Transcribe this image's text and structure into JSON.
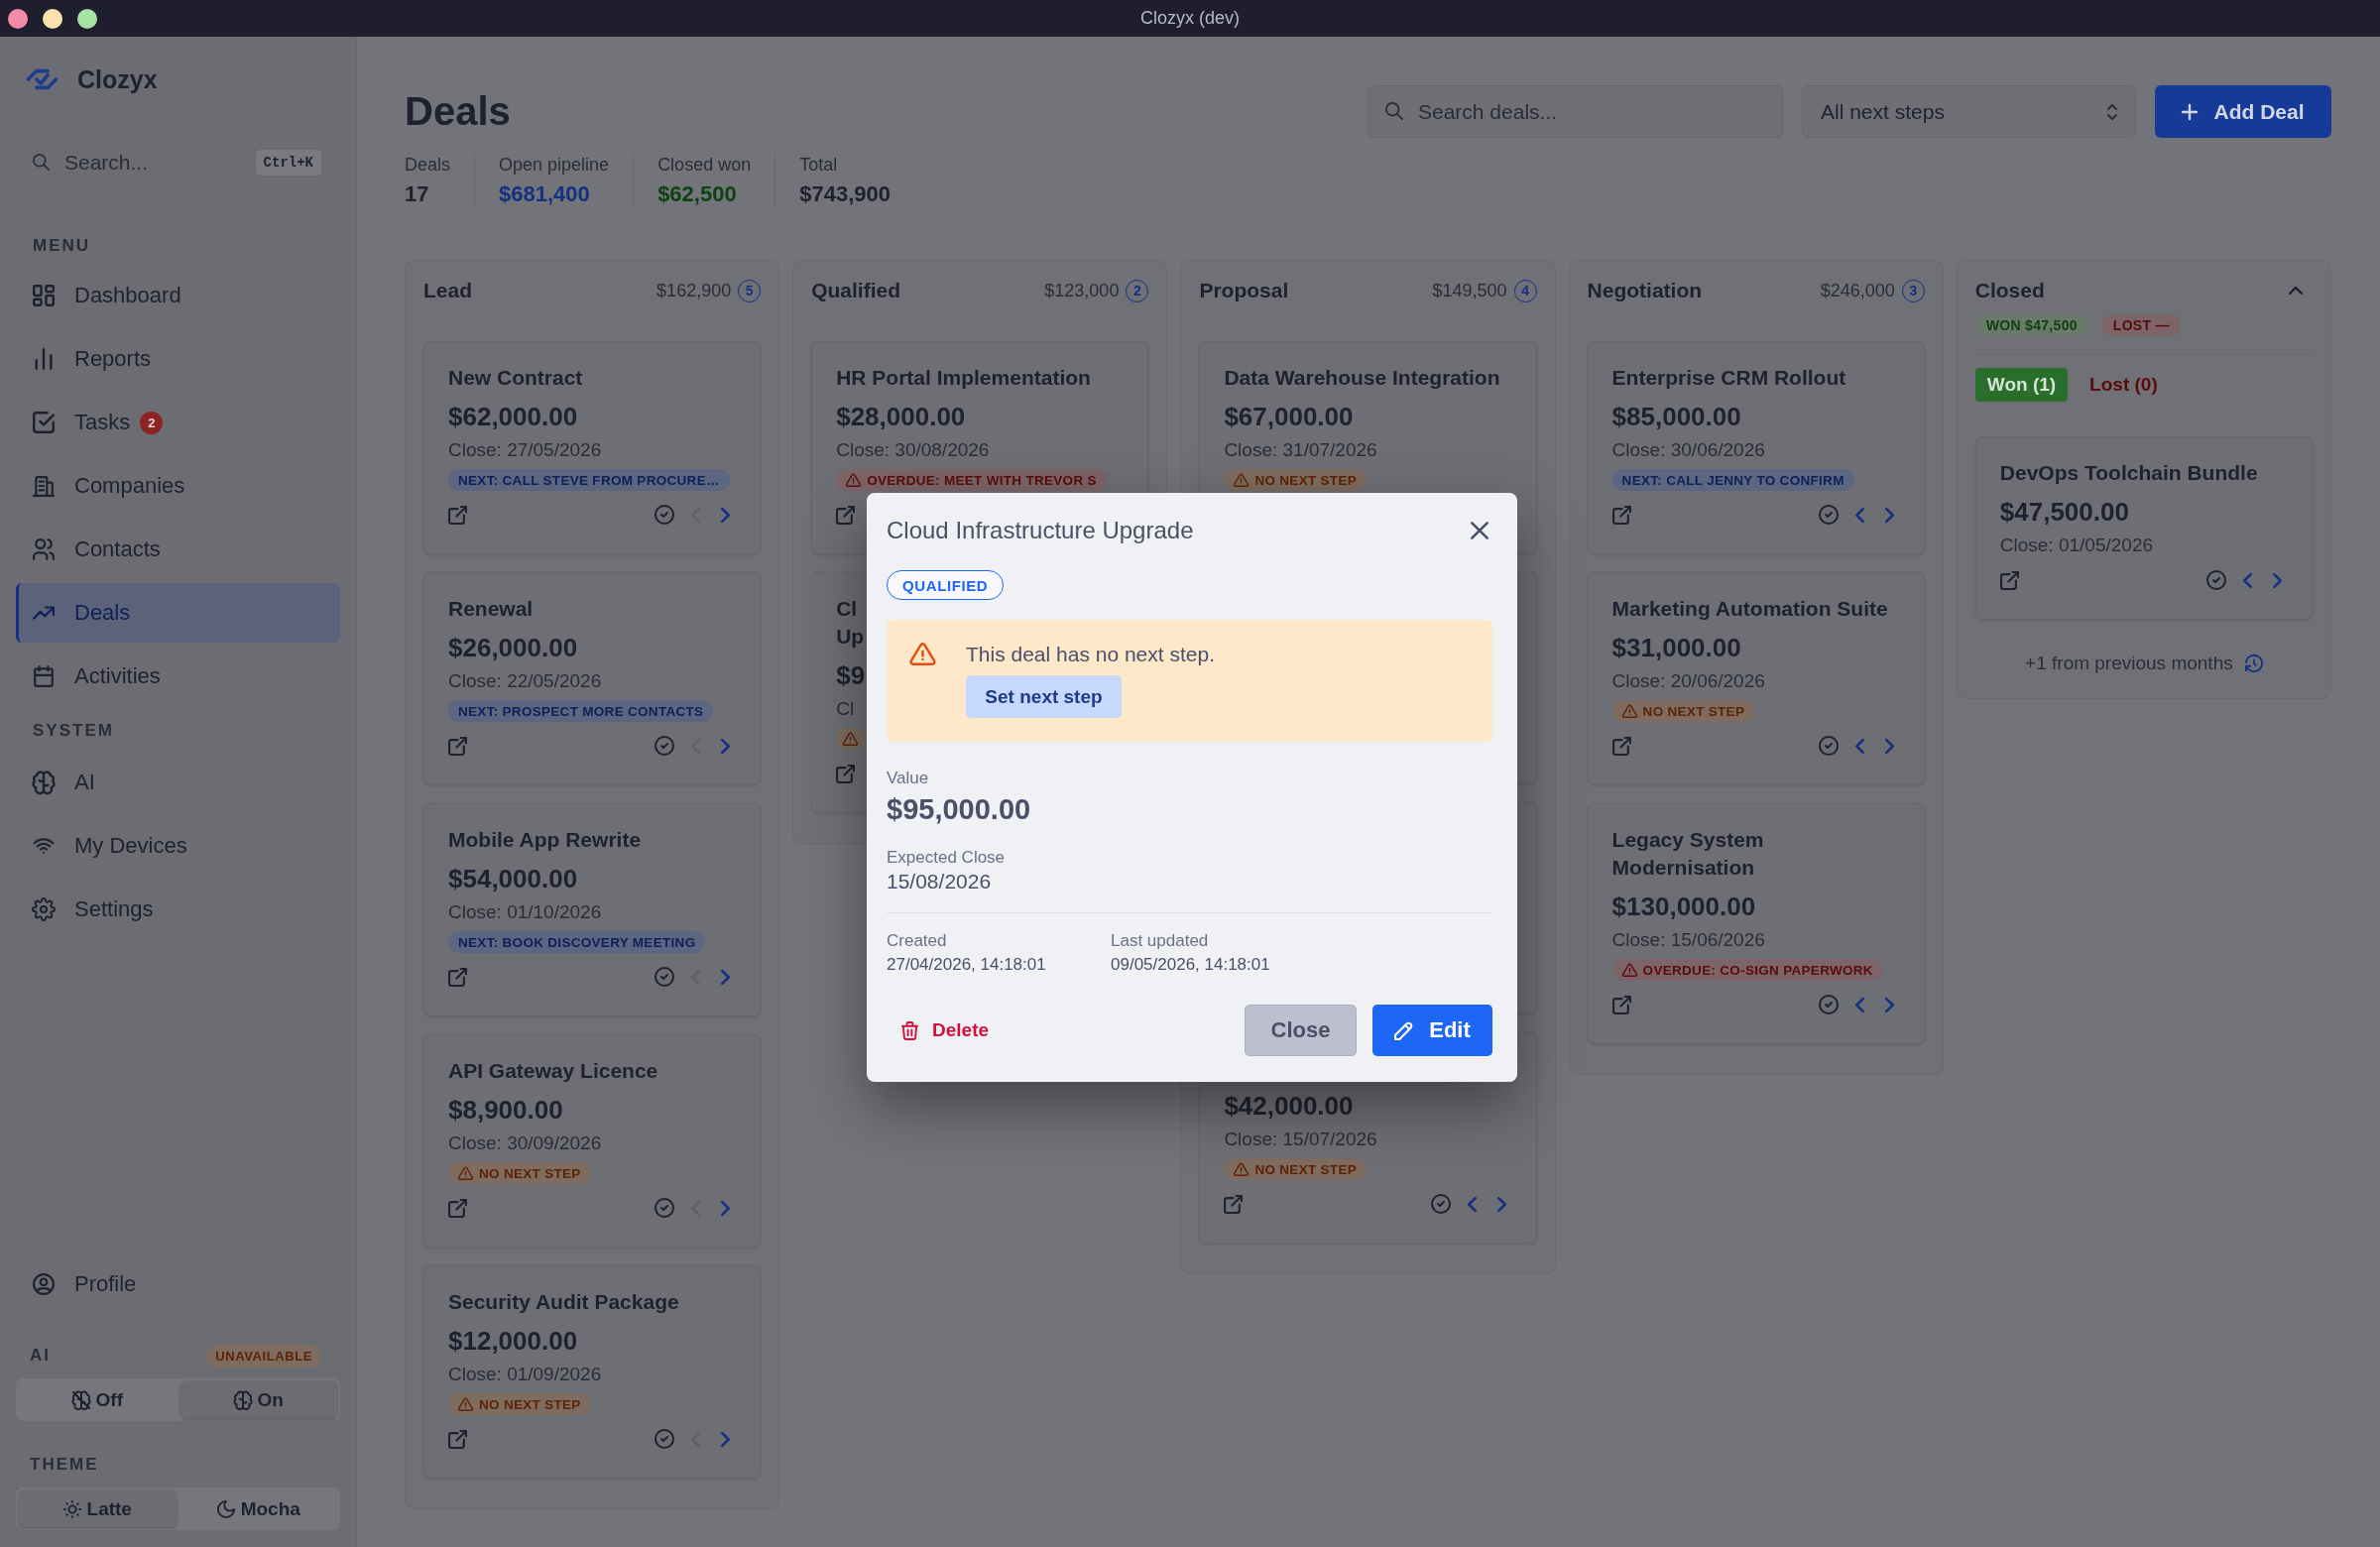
{
  "window": {
    "title": "Clozyx (dev)"
  },
  "sidebar": {
    "brand": "Clozyx",
    "search": {
      "placeholder": "Search...",
      "shortcut": "Ctrl+K"
    },
    "sections": [
      {
        "heading": "MENU",
        "items": [
          {
            "label": "Dashboard",
            "selected": false
          },
          {
            "label": "Reports",
            "selected": false
          },
          {
            "label": "Tasks",
            "selected": false,
            "badge": "2"
          },
          {
            "label": "Companies",
            "selected": false
          },
          {
            "label": "Contacts",
            "selected": false
          },
          {
            "label": "Deals",
            "selected": true
          },
          {
            "label": "Activities",
            "selected": false
          }
        ]
      },
      {
        "heading": "SYSTEM",
        "items": [
          {
            "label": "AI",
            "selected": false
          },
          {
            "label": "My Devices",
            "selected": false
          },
          {
            "label": "Settings",
            "selected": false
          }
        ]
      }
    ],
    "profile": {
      "label": "Profile"
    },
    "ai": {
      "heading": "AI",
      "status": "UNAVAILABLE",
      "options": [
        {
          "label": "Off",
          "selected": false
        },
        {
          "label": "On",
          "selected": true
        }
      ]
    },
    "theme": {
      "heading": "THEME",
      "options": [
        {
          "label": "Latte",
          "selected": true
        },
        {
          "label": "Mocha",
          "selected": false
        }
      ]
    }
  },
  "header": {
    "title": "Deals",
    "search": {
      "placeholder": "Search deals..."
    },
    "filter": {
      "value": "All next steps"
    },
    "add_button": "Add Deal"
  },
  "stats": [
    {
      "label": "Deals",
      "value": "17",
      "color": "#1f2130"
    },
    {
      "label": "Open pipeline",
      "value": "$681,400",
      "color": "#143080"
    },
    {
      "label": "Closed won",
      "value": "$62,500",
      "color": "#0f4212"
    },
    {
      "label": "Total",
      "value": "$743,900",
      "color": "#1f2130"
    }
  ],
  "columns": [
    {
      "name": "Lead",
      "total": "$162,900",
      "count": "5",
      "cards": [
        {
          "title": "New Contract",
          "amount": "$62,000.00",
          "close": "Close: 27/05/2026",
          "tag": {
            "kind": "next",
            "text": "NEXT: CALL STEVE FROM PROCURE…"
          },
          "actions": [
            {
              "kind": "link",
              "disabled": false
            },
            {
              "kind": "check",
              "disabled": false
            },
            {
              "kind": "prev",
              "disabled": true
            },
            {
              "kind": "next",
              "disabled": false
            }
          ]
        },
        {
          "title": "Renewal",
          "amount": "$26,000.00",
          "close": "Close: 22/05/2026",
          "tag": {
            "kind": "next",
            "text": "NEXT: PROSPECT MORE CONTACTS"
          },
          "actions": [
            {
              "kind": "link",
              "disabled": false
            },
            {
              "kind": "check",
              "disabled": false
            },
            {
              "kind": "prev",
              "disabled": true
            },
            {
              "kind": "next",
              "disabled": false
            }
          ]
        },
        {
          "title": "Mobile App Rewrite",
          "amount": "$54,000.00",
          "close": "Close: 01/10/2026",
          "tag": {
            "kind": "next",
            "text": "NEXT: BOOK DISCOVERY MEETING"
          },
          "actions": [
            {
              "kind": "link",
              "disabled": false
            },
            {
              "kind": "check",
              "disabled": false
            },
            {
              "kind": "prev",
              "disabled": true
            },
            {
              "kind": "next",
              "disabled": false
            }
          ]
        },
        {
          "title": "API Gateway Licence",
          "amount": "$8,900.00",
          "close": "Close: 30/09/2026",
          "tag": {
            "kind": "none",
            "text": "NO NEXT STEP"
          },
          "actions": [
            {
              "kind": "link",
              "disabled": false
            },
            {
              "kind": "check",
              "disabled": false
            },
            {
              "kind": "prev",
              "disabled": true
            },
            {
              "kind": "next",
              "disabled": false
            }
          ]
        },
        {
          "title": "Security Audit Package",
          "amount": "$12,000.00",
          "close": "Close: 01/09/2026",
          "tag": {
            "kind": "none",
            "text": "NO NEXT STEP"
          },
          "actions": [
            {
              "kind": "link",
              "disabled": false
            },
            {
              "kind": "check",
              "disabled": false
            },
            {
              "kind": "prev",
              "disabled": true
            },
            {
              "kind": "next",
              "disabled": false
            }
          ]
        }
      ]
    },
    {
      "name": "Qualified",
      "total": "$123,000",
      "count": "2",
      "cards": [
        {
          "title": "HR Portal Implementation",
          "amount": "$28,000.00",
          "close": "Close: 30/08/2026",
          "tag": {
            "kind": "overdue",
            "text": "OVERDUE: MEET WITH TREVOR S"
          },
          "actions": [
            {
              "kind": "link",
              "disabled": false
            }
          ]
        },
        {
          "title": "Cl\nUp",
          "amount": "$9",
          "close": "Cl",
          "tag": {
            "kind": "none"
          },
          "actions": [
            {
              "kind": "link",
              "disabled": false
            }
          ]
        }
      ]
    },
    {
      "name": "Proposal",
      "total": "$149,500",
      "count": "4",
      "cards": [
        {
          "kind": "deal",
          "title": "Data Warehouse Integration",
          "amount": "$67,000.00",
          "close": "Close: 31/07/2026",
          "tag": {
            "kind": "none",
            "text": "NO NEXT STEP"
          }
        },
        {
          "kind": "covered"
        },
        {
          "kind": "covered"
        },
        {
          "kind": "deal",
          "amount": "$42,000.00",
          "close": "Close: 15/07/2026",
          "tag": {
            "kind": "none",
            "text": "NO NEXT STEP"
          },
          "actions": [
            {
              "kind": "link",
              "disabled": false
            },
            {
              "kind": "check",
              "disabled": false
            },
            {
              "kind": "prev",
              "disabled": false
            },
            {
              "kind": "next",
              "disabled": false
            }
          ]
        }
      ]
    },
    {
      "name": "Negotiation",
      "total": "$246,000",
      "count": "3",
      "cards": [
        {
          "title": "Enterprise CRM Rollout",
          "amount": "$85,000.00",
          "close": "Close: 30/06/2026",
          "tag": {
            "kind": "next",
            "text": "NEXT: CALL JENNY TO CONFIRM"
          },
          "actions": [
            {
              "kind": "link",
              "disabled": false
            },
            {
              "kind": "check",
              "disabled": false
            },
            {
              "kind": "prev",
              "disabled": false
            },
            {
              "kind": "next",
              "disabled": false
            }
          ]
        },
        {
          "title": "Marketing Automation Suite",
          "amount": "$31,000.00",
          "close": "Close: 20/06/2026",
          "tag": {
            "kind": "none",
            "text": "NO NEXT STEP"
          },
          "actions": [
            {
              "kind": "link",
              "disabled": false
            },
            {
              "kind": "check",
              "disabled": false
            },
            {
              "kind": "prev",
              "disabled": false
            },
            {
              "kind": "next",
              "disabled": false
            }
          ]
        },
        {
          "title": "Legacy System Modernisation",
          "amount": "$130,000.00",
          "close": "Close: 15/06/2026",
          "tag": {
            "kind": "overdue",
            "text": "OVERDUE: CO-SIGN PAPERWORK"
          },
          "actions": [
            {
              "kind": "link",
              "disabled": false
            },
            {
              "kind": "check",
              "disabled": false
            },
            {
              "kind": "prev",
              "disabled": false
            },
            {
              "kind": "next",
              "disabled": false
            }
          ]
        }
      ]
    }
  ],
  "closed": {
    "name": "Closed",
    "expanded": true,
    "summary": [
      {
        "kind": "won",
        "text": "WON $47,500"
      },
      {
        "kind": "lost",
        "text": "LOST —"
      }
    ],
    "tabs": [
      {
        "kind": "won",
        "label": "Won (1)",
        "selected": true
      },
      {
        "kind": "lost",
        "label": "Lost (0)",
        "selected": false
      }
    ],
    "cards": [
      {
        "title": "DevOps Toolchain Bundle",
        "amount": "$47,500.00",
        "close": "Close: 01/05/2026",
        "actions": [
          {
            "kind": "link",
            "disabled": false
          },
          {
            "kind": "check",
            "disabled": false
          },
          {
            "kind": "prev",
            "disabled": false
          },
          {
            "kind": "next",
            "disabled": false
          }
        ]
      }
    ],
    "footer": "+1 from previous months"
  },
  "deal_modal": {
    "title": "Cloud Infrastructure Upgrade",
    "stage": "QUALIFIED",
    "alert": {
      "message": "This deal has no next step.",
      "action": "Set next step"
    },
    "fields": [
      {
        "kind": "amount",
        "label": "Value",
        "value": "$95,000.00"
      },
      {
        "kind": "date",
        "label": "Expected Close",
        "value": "15/08/2026"
      }
    ],
    "meta": [
      {
        "label": "Created",
        "value": "27/04/2026, 14:18:01"
      },
      {
        "label": "Last updated",
        "value": "09/05/2026, 14:18:01"
      }
    ],
    "buttons": [
      {
        "kind": "danger",
        "label": "Delete"
      },
      {
        "kind": "secondary",
        "label": "Close"
      },
      {
        "kind": "primary",
        "label": "Edit"
      }
    ]
  }
}
